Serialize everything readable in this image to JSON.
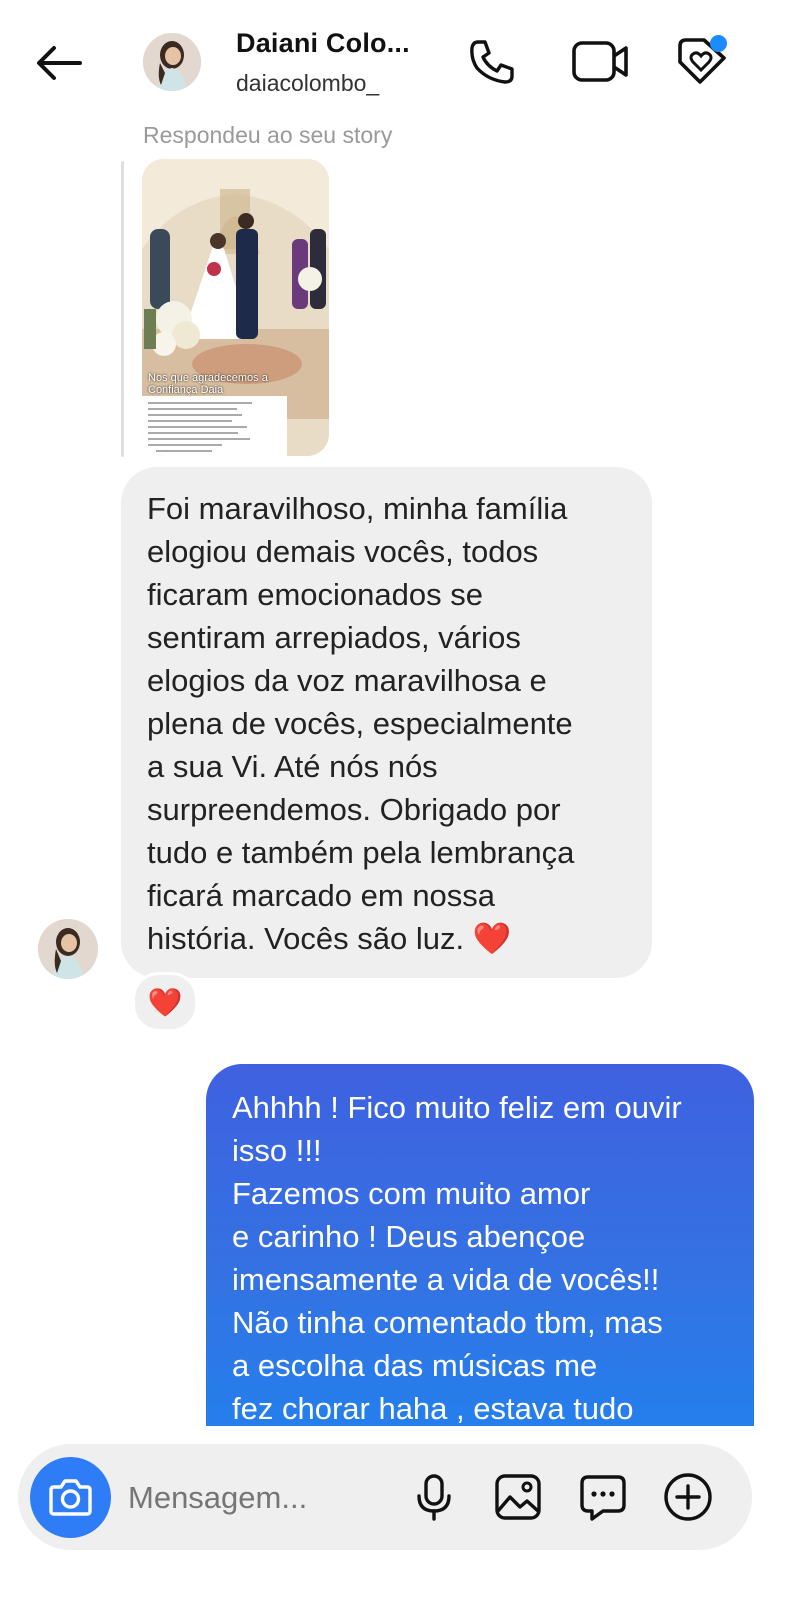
{
  "header": {
    "contact_name": "Daiani Colo...",
    "username": "daiacolombo_",
    "icons": [
      "back-arrow-icon",
      "phone-icon",
      "video-camera-icon",
      "tag-heart-icon"
    ]
  },
  "story_reply": {
    "label": "Respondeu ao seu story",
    "caption": "Nos que agradecemos a Confiança Daia"
  },
  "messages": {
    "received": {
      "text": "Foi maravilhoso, minha família\nelogiou demais vocês, todos\nficaram emocionados se\nsentiram arrepiados, vários\nelogios da voz maravilhosa e\nplena de vocês, especialmente\na sua Vi. Até nós nós\nsurpreendemos. Obrigado por\ntudo e também pela lembrança\nficará marcado em nossa\nhistória. Vocês são luz.",
      "emoji": "❤️",
      "reaction": "❤️"
    },
    "sent": {
      "text": "Ahhhh ! Fico muito feliz em ouvir\nisso !!!\nFazemos com muito amor\ne carinho ! Deus abençoe\nimensamente a vida de vocês!!\nNão tinha comentado tbm, mas\na escolha das músicas me\nfez chorar haha , estava tudo"
    }
  },
  "composer": {
    "placeholder": "Mensagem...",
    "icons": [
      "camera-icon",
      "microphone-icon",
      "gallery-icon",
      "sticker-chat-icon",
      "plus-circle-icon"
    ]
  },
  "colors": {
    "accent_blue": "#2f7df6",
    "sent_gradient_top": "#3f61e0",
    "sent_gradient_bottom": "#1f83f0",
    "received_bg": "#efefef",
    "notification_dot": "#1a8cff"
  }
}
